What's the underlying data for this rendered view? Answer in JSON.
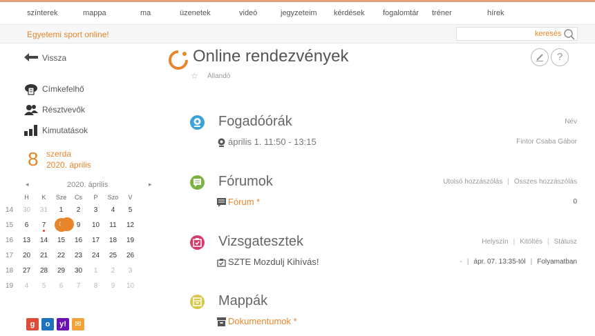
{
  "topnav": {
    "items": [
      "színterek",
      "mappa",
      "ma",
      "üzenetek",
      "videó",
      "jegyzeteim",
      "kérdések",
      "fogalomtár",
      "tréner",
      "hírek"
    ]
  },
  "subbar": {
    "title": "Egyetemi sport online!",
    "search_placeholder": "",
    "search_label": "keresés"
  },
  "sidebar": {
    "back": "Vissza",
    "items": [
      "Címkefelhő",
      "Résztvevők",
      "Kimutatások"
    ],
    "day_number": "8",
    "day_name": "szerda",
    "date_text": "2020. április"
  },
  "calendar": {
    "month_label": "2020. április",
    "prev": "◂",
    "next": "▸",
    "weekdays": [
      "H",
      "K",
      "Sze",
      "Cs",
      "P",
      "Szo",
      "V"
    ],
    "weeks": [
      {
        "wk": "14",
        "days": [
          "30",
          "31",
          "1",
          "2",
          "3",
          "4",
          "5"
        ],
        "other": [
          0,
          1
        ]
      },
      {
        "wk": "15",
        "days": [
          "6",
          "7",
          "8",
          "9",
          "10",
          "11",
          "12"
        ],
        "other": []
      },
      {
        "wk": "16",
        "days": [
          "13",
          "14",
          "15",
          "16",
          "17",
          "18",
          "19"
        ],
        "other": []
      },
      {
        "wk": "17",
        "days": [
          "20",
          "21",
          "22",
          "23",
          "24",
          "25",
          "26"
        ],
        "other": []
      },
      {
        "wk": "18",
        "days": [
          "27",
          "28",
          "29",
          "30",
          "1",
          "2",
          "3"
        ],
        "other": [
          4,
          5,
          6
        ]
      },
      {
        "wk": "19",
        "days": [
          "4",
          "5",
          "6",
          "7",
          "8",
          "9",
          "10"
        ],
        "other": [
          0,
          1,
          2,
          3,
          4,
          5,
          6
        ]
      }
    ],
    "today": "8"
  },
  "social": [
    {
      "icon": "google-icon",
      "glyph": "g",
      "color": "#dd4b39"
    },
    {
      "icon": "outlook-icon",
      "glyph": "o",
      "color": "#1e73be"
    },
    {
      "icon": "yahoo-icon",
      "glyph": "y!",
      "color": "#6b0fb0"
    },
    {
      "icon": "mail-icon",
      "glyph": "✉",
      "color": "#f2a33a"
    }
  ],
  "main": {
    "title": "Online rendezvények",
    "subtitle": "Állandó",
    "sections": {
      "fogado": {
        "title": "Fogadóórák",
        "right": "Név",
        "item": "április 1. 11:50 - 13:15",
        "value": "Fintor Csaba Gábor",
        "color": "#3aa3d9"
      },
      "forum": {
        "title": "Fórumok",
        "right1": "Utolsó hozzászólás",
        "right2": "Összes hozzászólás",
        "item": "Fórum *",
        "value": "0",
        "color": "#7cb342"
      },
      "vizsga": {
        "title": "Vizsgatesztek",
        "right1": "Helyszín",
        "right2": "Kitöltés",
        "right3": "Státusz",
        "item": "SZTE Mozdulj Kihívás!",
        "val1": "-",
        "val2": "ápr. 07. 13:35-tól",
        "val3": "Folyamatban",
        "color": "#d63a6b"
      },
      "mappak": {
        "title": "Mappák",
        "item": "Dokumentumok *",
        "color": "#d7c84a"
      }
    }
  },
  "colors": {
    "accent": "#e8852a",
    "text": "#555555"
  }
}
